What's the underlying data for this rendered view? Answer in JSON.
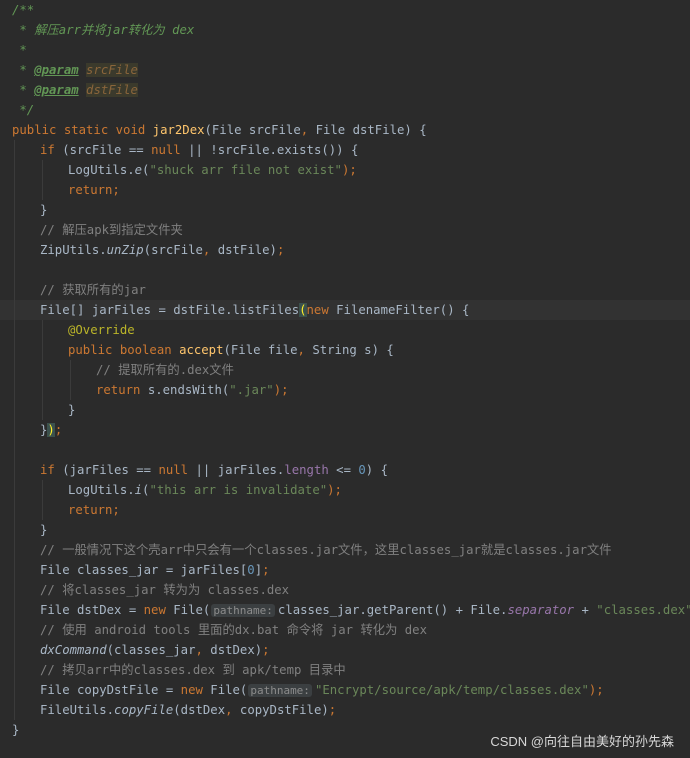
{
  "watermark": "CSDN @向往自由美好的孙先森",
  "colors": {
    "background": "#2b2b2b",
    "keyword": "#cc7832",
    "method": "#ffc66d",
    "comment": "#808080",
    "doc": "#629755",
    "string": "#6a8759",
    "number": "#6897bb",
    "annotation": "#bbb529",
    "field": "#9876aa",
    "text": "#a9b7c6"
  },
  "icons": {
    "gutter": "lightbulb-icon"
  },
  "lines": [
    {
      "indent": 0,
      "tokens": [
        {
          "t": "/**",
          "c": "doc"
        }
      ]
    },
    {
      "indent": 0,
      "tokens": [
        {
          "t": " * 解压arr并将jar转化为 dex",
          "c": "doc"
        }
      ]
    },
    {
      "indent": 0,
      "tokens": [
        {
          "t": " *",
          "c": "doc"
        }
      ]
    },
    {
      "indent": 0,
      "tokens": [
        {
          "t": " * ",
          "c": "doc"
        },
        {
          "t": "@param",
          "c": "doctag"
        },
        {
          "t": " ",
          "c": "doc"
        },
        {
          "t": "srcFile",
          "c": "docval"
        }
      ]
    },
    {
      "indent": 0,
      "tokens": [
        {
          "t": " * ",
          "c": "doc"
        },
        {
          "t": "@param",
          "c": "doctag"
        },
        {
          "t": " ",
          "c": "doc"
        },
        {
          "t": "dstFile",
          "c": "docval"
        }
      ]
    },
    {
      "indent": 0,
      "tokens": [
        {
          "t": " */",
          "c": "doc"
        }
      ]
    },
    {
      "indent": 0,
      "tokens": [
        {
          "t": "public static void ",
          "c": "kw"
        },
        {
          "t": "jar2Dex",
          "c": "fn"
        },
        {
          "t": "(File srcFile",
          "c": ""
        },
        {
          "t": ", ",
          "c": "kw"
        },
        {
          "t": "File dstFile) {",
          "c": ""
        }
      ]
    },
    {
      "indent": 1,
      "tokens": [
        {
          "t": "if ",
          "c": "kw"
        },
        {
          "t": "(srcFile == ",
          "c": ""
        },
        {
          "t": "null ",
          "c": "kw"
        },
        {
          "t": "|| !srcFile.exists()) {",
          "c": ""
        }
      ]
    },
    {
      "indent": 2,
      "tokens": [
        {
          "t": "LogUtils.",
          "c": ""
        },
        {
          "t": "e",
          "c": "static"
        },
        {
          "t": "(",
          "c": ""
        },
        {
          "t": "\"shuck arr file not exist\"",
          "c": "str"
        },
        {
          "t": ");",
          "c": "kw"
        }
      ]
    },
    {
      "indent": 2,
      "tokens": [
        {
          "t": "return;",
          "c": "kw"
        }
      ]
    },
    {
      "indent": 1,
      "tokens": [
        {
          "t": "}",
          "c": ""
        }
      ]
    },
    {
      "indent": 1,
      "tokens": [
        {
          "t": "// 解压apk到指定文件夹",
          "c": "cm"
        }
      ]
    },
    {
      "indent": 1,
      "tokens": [
        {
          "t": "ZipUtils.",
          "c": ""
        },
        {
          "t": "unZip",
          "c": "static"
        },
        {
          "t": "(srcFile",
          "c": ""
        },
        {
          "t": ", ",
          "c": "kw"
        },
        {
          "t": "dstFile)",
          "c": ""
        },
        {
          "t": ";",
          "c": "kw"
        }
      ]
    },
    {
      "indent": 1,
      "tokens": []
    },
    {
      "indent": 1,
      "tokens": [
        {
          "t": "// 获取所有的jar",
          "c": "cm"
        }
      ]
    },
    {
      "indent": 1,
      "current": true,
      "bulb": true,
      "tokens": [
        {
          "t": "File[] jarFiles = dstFile.listFiles",
          "c": ""
        },
        {
          "t": "(",
          "c": "brace"
        },
        {
          "t": "new ",
          "c": "kw"
        },
        {
          "t": "FilenameFilter() {",
          "c": ""
        }
      ]
    },
    {
      "indent": 2,
      "tokens": [
        {
          "t": "@Override",
          "c": "anno"
        }
      ]
    },
    {
      "indent": 2,
      "tokens": [
        {
          "t": "public boolean ",
          "c": "kw"
        },
        {
          "t": "accept",
          "c": "fn"
        },
        {
          "t": "(File file",
          "c": ""
        },
        {
          "t": ", ",
          "c": "kw"
        },
        {
          "t": "String s) {",
          "c": ""
        }
      ]
    },
    {
      "indent": 3,
      "tokens": [
        {
          "t": "// 提取所有的.dex文件",
          "c": "cm"
        }
      ]
    },
    {
      "indent": 3,
      "tokens": [
        {
          "t": "return ",
          "c": "kw"
        },
        {
          "t": "s.endsWith(",
          "c": ""
        },
        {
          "t": "\".jar\"",
          "c": "str"
        },
        {
          "t": ");",
          "c": "kw"
        }
      ]
    },
    {
      "indent": 2,
      "tokens": [
        {
          "t": "}",
          "c": ""
        }
      ]
    },
    {
      "indent": 1,
      "tokens": [
        {
          "t": "}",
          "c": ""
        },
        {
          "t": ")",
          "c": "brace"
        },
        {
          "t": ";",
          "c": "kw"
        }
      ]
    },
    {
      "indent": 1,
      "tokens": []
    },
    {
      "indent": 1,
      "tokens": [
        {
          "t": "if ",
          "c": "kw"
        },
        {
          "t": "(jarFiles == ",
          "c": ""
        },
        {
          "t": "null ",
          "c": "kw"
        },
        {
          "t": "|| jarFiles.",
          "c": ""
        },
        {
          "t": "length ",
          "c": "field"
        },
        {
          "t": "<= ",
          "c": ""
        },
        {
          "t": "0",
          "c": "num"
        },
        {
          "t": ") {",
          "c": ""
        }
      ]
    },
    {
      "indent": 2,
      "tokens": [
        {
          "t": "LogUtils.",
          "c": ""
        },
        {
          "t": "i",
          "c": "static"
        },
        {
          "t": "(",
          "c": ""
        },
        {
          "t": "\"this arr is invalidate\"",
          "c": "str"
        },
        {
          "t": ");",
          "c": "kw"
        }
      ]
    },
    {
      "indent": 2,
      "tokens": [
        {
          "t": "return;",
          "c": "kw"
        }
      ]
    },
    {
      "indent": 1,
      "tokens": [
        {
          "t": "}",
          "c": ""
        }
      ]
    },
    {
      "indent": 1,
      "tokens": [
        {
          "t": "// 一般情况下这个壳arr中只会有一个classes.jar文件，这里classes_jar就是classes.jar文件",
          "c": "cm"
        }
      ]
    },
    {
      "indent": 1,
      "tokens": [
        {
          "t": "File classes_jar = jarFiles[",
          "c": ""
        },
        {
          "t": "0",
          "c": "num"
        },
        {
          "t": "]",
          "c": ""
        },
        {
          "t": ";",
          "c": "kw"
        }
      ]
    },
    {
      "indent": 1,
      "tokens": [
        {
          "t": "// 将classes_jar 转为为 classes.dex",
          "c": "cm"
        }
      ]
    },
    {
      "indent": 1,
      "tokens": [
        {
          "t": "File dstDex = ",
          "c": ""
        },
        {
          "t": "new ",
          "c": "kw"
        },
        {
          "t": "File(",
          "c": ""
        },
        {
          "t": "pathname:",
          "c": "hint"
        },
        {
          "t": "classes_jar.getParent() + File.",
          "c": ""
        },
        {
          "t": "separator ",
          "c": "fieldi"
        },
        {
          "t": "+ ",
          "c": ""
        },
        {
          "t": "\"classes.dex\"",
          "c": "str"
        },
        {
          "t": ");",
          "c": "kw"
        }
      ]
    },
    {
      "indent": 1,
      "tokens": [
        {
          "t": "// 使用 android tools 里面的dx.bat 命令将 jar 转化为 dex",
          "c": "cm"
        }
      ]
    },
    {
      "indent": 1,
      "tokens": [
        {
          "t": "dxCommand",
          "c": "static"
        },
        {
          "t": "(classes_jar",
          "c": ""
        },
        {
          "t": ", ",
          "c": "kw"
        },
        {
          "t": "dstDex)",
          "c": ""
        },
        {
          "t": ";",
          "c": "kw"
        }
      ]
    },
    {
      "indent": 1,
      "tokens": [
        {
          "t": "// 拷贝arr中的classes.dex 到 apk/temp 目录中",
          "c": "cm"
        }
      ]
    },
    {
      "indent": 1,
      "tokens": [
        {
          "t": "File copyDstFile = ",
          "c": ""
        },
        {
          "t": "new ",
          "c": "kw"
        },
        {
          "t": "File(",
          "c": ""
        },
        {
          "t": "pathname:",
          "c": "hint"
        },
        {
          "t": "\"Encrypt/source/apk/temp/classes.dex\"",
          "c": "str"
        },
        {
          "t": ");",
          "c": "kw"
        }
      ]
    },
    {
      "indent": 1,
      "tokens": [
        {
          "t": "FileUtils.",
          "c": ""
        },
        {
          "t": "copyFile",
          "c": "static"
        },
        {
          "t": "(dstDex",
          "c": ""
        },
        {
          "t": ", ",
          "c": "kw"
        },
        {
          "t": "copyDstFile)",
          "c": ""
        },
        {
          "t": ";",
          "c": "kw"
        }
      ]
    },
    {
      "indent": 0,
      "tokens": [
        {
          "t": "}",
          "c": ""
        }
      ]
    }
  ]
}
